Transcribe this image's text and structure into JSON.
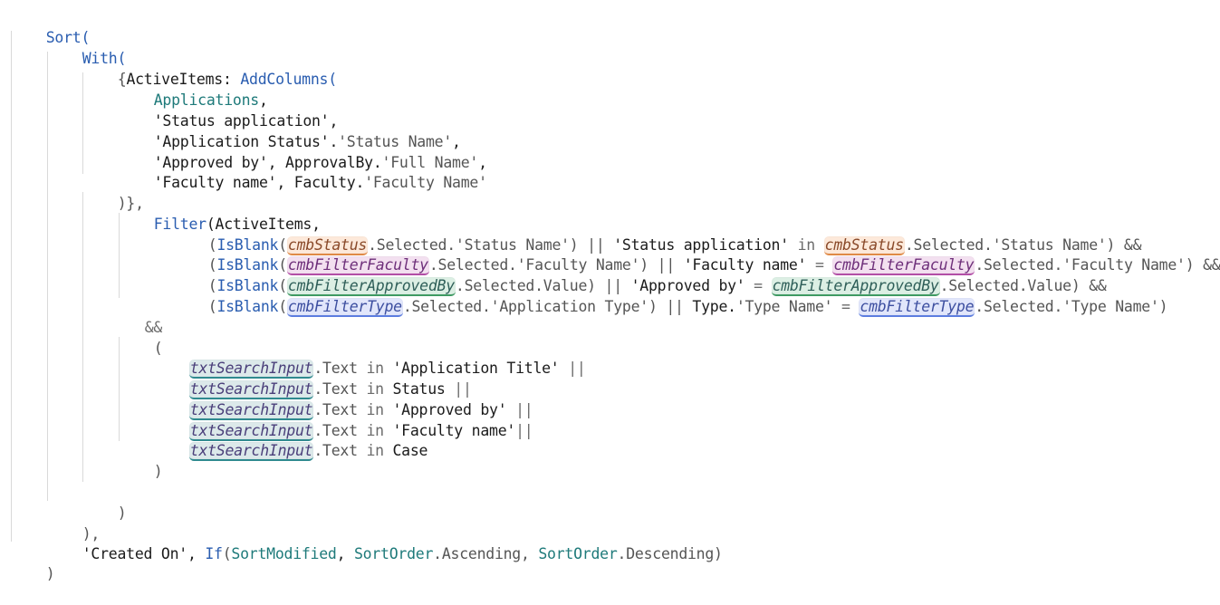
{
  "code": {
    "l1": {
      "t1": "Sort("
    },
    "l2": {
      "t1": "With("
    },
    "l3": {
      "t1": "{",
      "t2": "ActiveItems",
      "t3": ": ",
      "t4": "AddColumns",
      "t5": "("
    },
    "l4": {
      "t1": "Applications",
      "t2": ","
    },
    "l5": {
      "t1": "'Status application'",
      "t2": ","
    },
    "l6": {
      "t1": "'Application Status'",
      ".": ".",
      "t2": "'Status Name'",
      "t3": ","
    },
    "l7": {
      "t1": "'Approved by'",
      "t2": ", ",
      "t3": "ApprovalBy",
      "t4": ".",
      "t5": "'Full Name'",
      "t6": ","
    },
    "l8": {
      "t1": "'Faculty name'",
      "t2": ", ",
      "t3": "Faculty",
      "t4": ".",
      "t5": "'Faculty Name'"
    },
    "l9": {
      "t1": ")},"
    },
    "l10": {
      "t1": "Filter",
      "t2": "(ActiveItems,"
    },
    "l11": {
      "t1": "(",
      "t2": "IsBlank",
      "t3": "(",
      "t4": "cmbStatus",
      "t5": ".Selected.'Status Name') || ",
      "t6": "'Status application'",
      "t7": " in ",
      "t8": "cmbStatus",
      "t9": ".Selected.'Status Name') &&"
    },
    "l12": {
      "t1": "(",
      "t2": "IsBlank",
      "t3": "(",
      "t4": "cmbFilterFaculty",
      "t5": ".Selected.'Faculty Name') || ",
      "t6": "'Faculty name'",
      "t7": " = ",
      "t8": "cmbFilterFaculty",
      "t9": ".Selected.'Faculty Name') &&"
    },
    "l13": {
      "t1": "(",
      "t2": "IsBlank",
      "t3": "(",
      "t4": "cmbFilterApprovedBy",
      "t5": ".Selected.Value) || ",
      "t6": "'Approved by'",
      "t7": " = ",
      "t8": "cmbFilterApprovedBy",
      "t9": ".Selected.Value) &&"
    },
    "l14": {
      "t1": "(",
      "t2": "IsBlank",
      "t3": "(",
      "t4": "cmbFilterType",
      "t5": ".Selected.'Application Type') || ",
      "t6": "Type.",
      "t7": "'Type Name'",
      "t8": " = ",
      "t9": "cmbFilterType",
      "t10": ".Selected.'Type Name')"
    },
    "l15": {
      "t1": "&&"
    },
    "l16": {
      "t1": "("
    },
    "l17": {
      "t1": "txtSearchInput",
      "t2": ".Text ",
      "t3": "in",
      "t4": " 'Application Title' ",
      "t5": "||"
    },
    "l18": {
      "t1": "txtSearchInput",
      "t2": ".Text ",
      "t3": "in",
      "t4": " Status ",
      "t5": "||"
    },
    "l19": {
      "t1": "txtSearchInput",
      "t2": ".Text ",
      "t3": "in",
      "t4": " 'Approved by' ",
      "t5": "||"
    },
    "l20": {
      "t1": "txtSearchInput",
      "t2": ".Text ",
      "t3": "in",
      "t4": " 'Faculty name'",
      "t5": "||"
    },
    "l21": {
      "t1": "txtSearchInput",
      "t2": ".Text ",
      "t3": "in",
      "t4": " Case"
    },
    "l22": {
      "t1": ")"
    },
    "l24": {
      "t1": ")"
    },
    "l25": {
      "t1": "),"
    },
    "l26": {
      "t1": "'Created On'",
      "t2": ", ",
      "t3": "If",
      "t4": "(",
      "t5": "SortModified",
      "t6": ", ",
      "t7": "SortOrder",
      "t8": ".Ascending, ",
      "t9": "SortOrder",
      "t10": ".Descending)"
    },
    "l27": {
      "t1": ")"
    }
  },
  "colors": {
    "function": "#2a5db0",
    "keyword": "#1e7a7a",
    "control_orange": "#e08a47",
    "control_pink": "#b34ea6",
    "control_green": "#3f9a63",
    "control_blue": "#5c7de0",
    "control_teal": "#2f8a8f"
  }
}
